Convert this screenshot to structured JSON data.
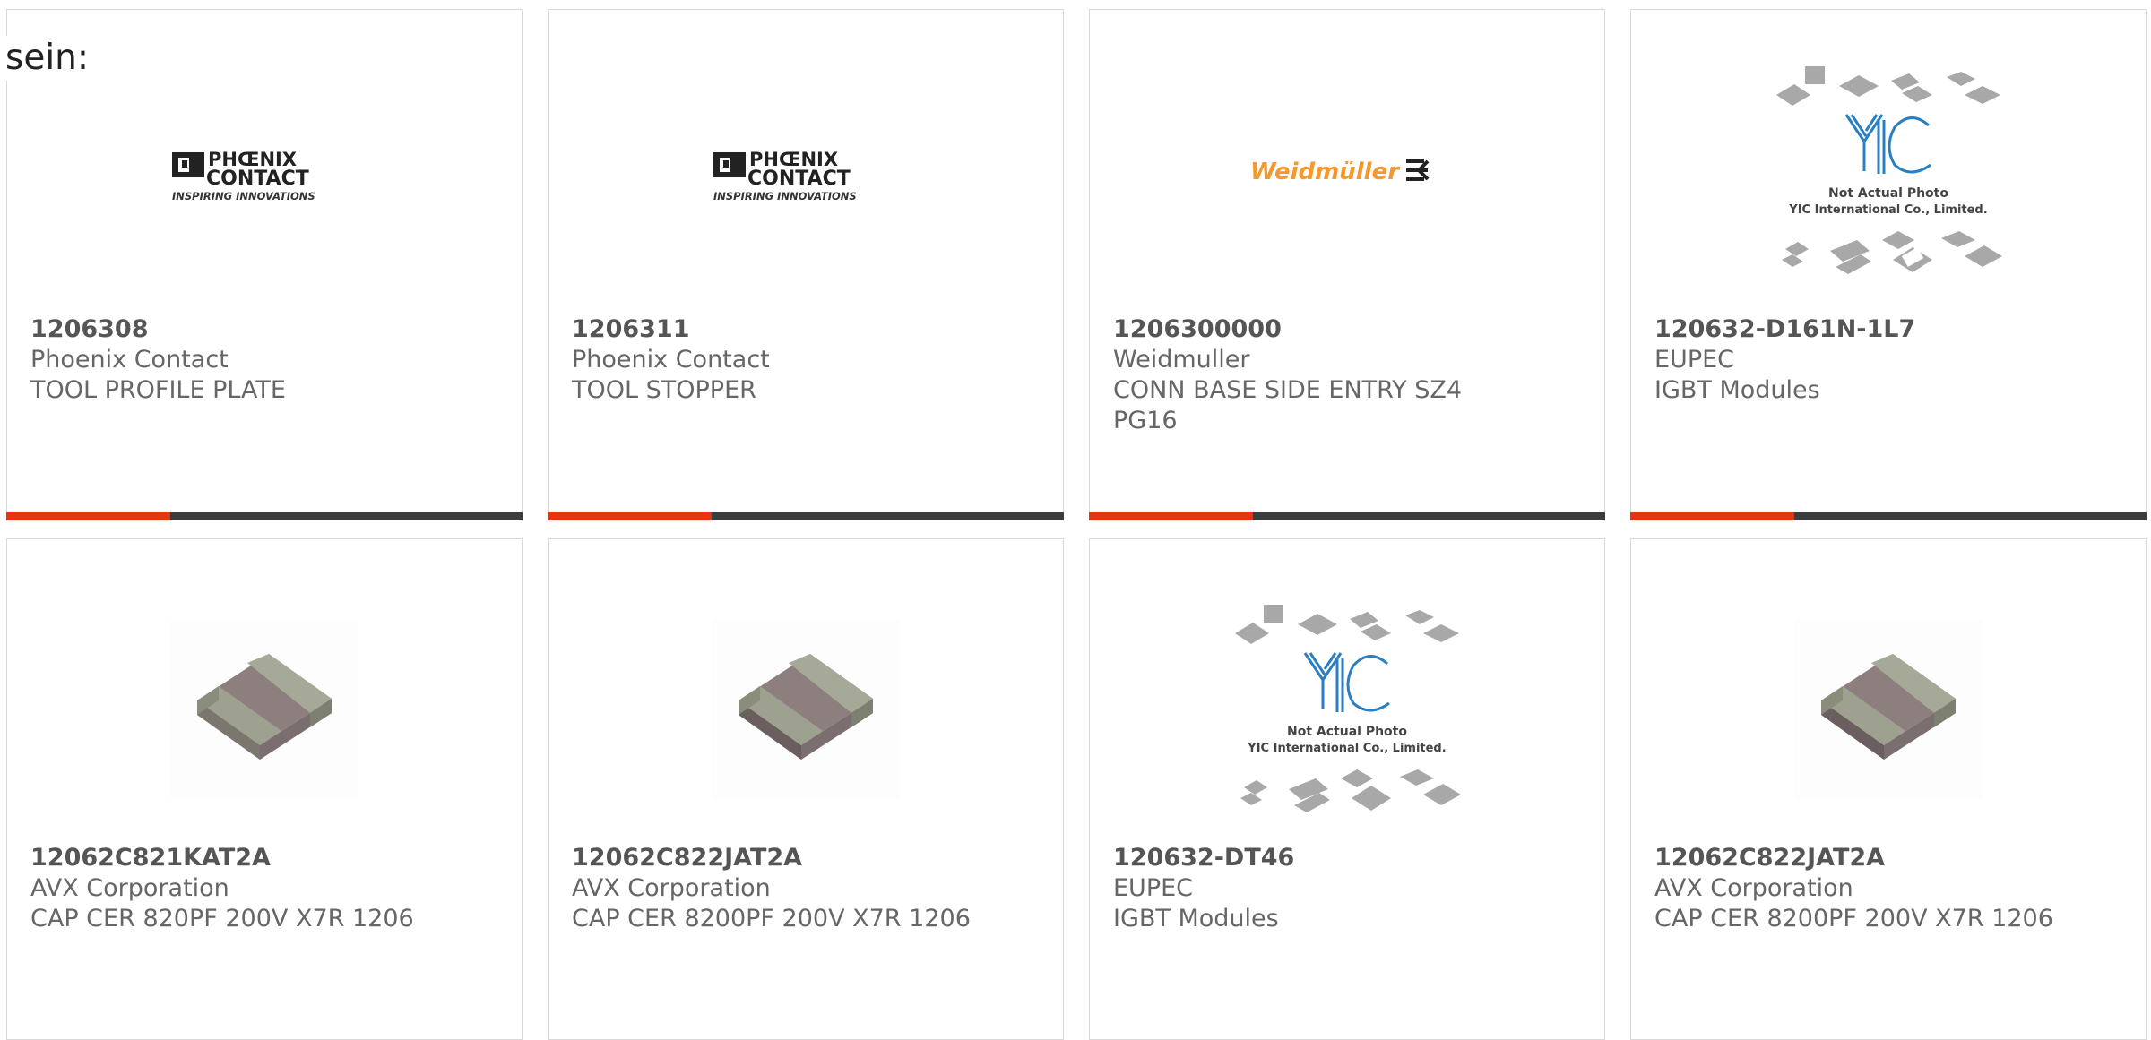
{
  "intro_text": "sein:",
  "colors": {
    "accent": "#e63312",
    "bar_dark": "#3c3c3c",
    "text": "#666666"
  },
  "products": [
    {
      "part": "1206308",
      "maker": "Phoenix Contact",
      "desc": "TOOL PROFILE PLATE",
      "desc2": "",
      "image": "phoenix-contact-logo",
      "logo": {
        "line1": "PHŒNIX",
        "line2": "CONTACT",
        "tagline": "INSPIRING INNOVATIONS"
      }
    },
    {
      "part": "1206311",
      "maker": "Phoenix Contact",
      "desc": "TOOL STOPPER",
      "desc2": "",
      "image": "phoenix-contact-logo",
      "logo": {
        "line1": "PHŒNIX",
        "line2": "CONTACT",
        "tagline": "INSPIRING INNOVATIONS"
      }
    },
    {
      "part": "1206300000",
      "maker": "Weidmuller",
      "desc": "CONN BASE SIDE ENTRY SZ4",
      "desc2": "PG16",
      "image": "weidmuller-logo",
      "logo": {
        "text": "Weidmüller"
      }
    },
    {
      "part": "120632-D161N-1L7",
      "maker": "EUPEC",
      "desc": "IGBT Modules",
      "desc2": "",
      "image": "yic-placeholder",
      "logo": {
        "line1": "Not Actual Photo",
        "line2": "YIC International Co., Limited."
      }
    },
    {
      "part": "12062C821KAT2A",
      "maker": "AVX Corporation",
      "desc": "CAP CER 820PF 200V X7R 1206",
      "desc2": "",
      "image": "ceramic-capacitor-photo"
    },
    {
      "part": "12062C822JAT2A",
      "maker": "AVX Corporation",
      "desc": "CAP CER 8200PF 200V X7R 1206",
      "desc2": "",
      "image": "ceramic-capacitor-photo"
    },
    {
      "part": "120632-DT46",
      "maker": "EUPEC",
      "desc": "IGBT Modules",
      "desc2": "",
      "image": "yic-placeholder",
      "logo": {
        "line1": "Not Actual Photo",
        "line2": "YIC International Co., Limited."
      }
    },
    {
      "part": "12062C822JAT2A",
      "maker": "AVX Corporation",
      "desc": "CAP CER 8200PF 200V X7R 1206",
      "desc2": "",
      "image": "ceramic-capacitor-photo"
    }
  ]
}
